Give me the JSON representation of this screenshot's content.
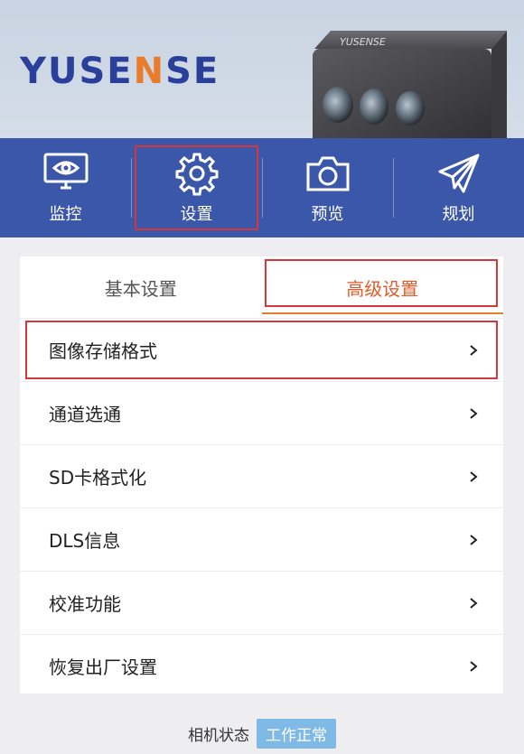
{
  "header": {
    "brand_text": "YUSENSE",
    "camera_brand": "YUSENSE",
    "brand_color": "#2a3f9a",
    "brand_accent_color": "#e87b2c"
  },
  "navbar": {
    "bg_color": "#3a57a9",
    "items": [
      {
        "label": "监控",
        "icon": "monitor-eye-icon",
        "active": false
      },
      {
        "label": "设置",
        "icon": "gear-icon",
        "active": true
      },
      {
        "label": "预览",
        "icon": "camera-icon",
        "active": false
      },
      {
        "label": "规划",
        "icon": "paper-plane-icon",
        "active": false
      }
    ]
  },
  "tabs": {
    "basic_label": "基本设置",
    "advanced_label": "高级设置",
    "active": "advanced",
    "accent_color": "#e05a2a"
  },
  "menu": {
    "items": [
      {
        "label": "图像存储格式",
        "selected": true
      },
      {
        "label": "通道选通",
        "selected": false
      },
      {
        "label": "SD卡格式化",
        "selected": false
      },
      {
        "label": "DLS信息",
        "selected": false
      },
      {
        "label": "校准功能",
        "selected": false
      },
      {
        "label": "恢复出厂设置",
        "selected": false
      }
    ],
    "highlight_color": "#d8363a"
  },
  "status": {
    "label": "相机状态",
    "value": "工作正常",
    "badge_color": "#7fb9e6"
  }
}
